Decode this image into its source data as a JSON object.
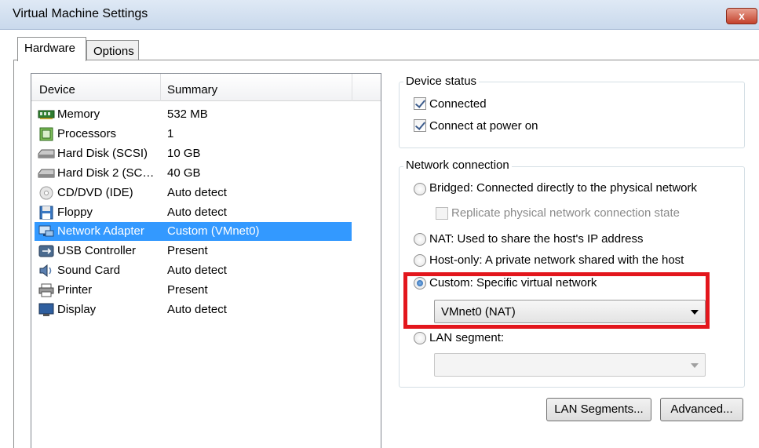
{
  "window": {
    "title": "Virtual Machine Settings",
    "close_label": "x"
  },
  "tabs": [
    {
      "label": "Hardware",
      "active": true
    },
    {
      "label": "Options",
      "active": false
    }
  ],
  "device_list": {
    "headers": {
      "device": "Device",
      "summary": "Summary"
    },
    "rows": [
      {
        "icon": "memory-icon",
        "device": "Memory",
        "summary": "532 MB"
      },
      {
        "icon": "processor-icon",
        "device": "Processors",
        "summary": "1"
      },
      {
        "icon": "hard-disk-icon",
        "device": "Hard Disk (SCSI)",
        "summary": "10 GB"
      },
      {
        "icon": "hard-disk-icon",
        "device": "Hard Disk 2 (SC…",
        "summary": "40 GB"
      },
      {
        "icon": "cd-dvd-icon",
        "device": "CD/DVD (IDE)",
        "summary": "Auto detect"
      },
      {
        "icon": "floppy-icon",
        "device": "Floppy",
        "summary": "Auto detect"
      },
      {
        "icon": "network-adapter-icon",
        "device": "Network Adapter",
        "summary": "Custom (VMnet0)",
        "selected": true
      },
      {
        "icon": "usb-icon",
        "device": "USB Controller",
        "summary": "Present"
      },
      {
        "icon": "sound-icon",
        "device": "Sound Card",
        "summary": "Auto detect"
      },
      {
        "icon": "printer-icon",
        "device": "Printer",
        "summary": "Present"
      },
      {
        "icon": "display-icon",
        "device": "Display",
        "summary": "Auto detect"
      }
    ]
  },
  "device_status": {
    "label": "Device status",
    "connected": {
      "label": "Connected",
      "checked": true
    },
    "connect_at_power_on": {
      "label": "Connect at power on",
      "checked": true
    }
  },
  "network_connection": {
    "label": "Network connection",
    "bridged": {
      "label": "Bridged: Connected directly to the physical network",
      "selected": false
    },
    "replicate": {
      "label": "Replicate physical network connection state",
      "checked": false,
      "enabled": false
    },
    "nat": {
      "label": "NAT: Used to share the host's IP address",
      "selected": false
    },
    "host_only": {
      "label": "Host-only: A private network shared with the host",
      "selected": false
    },
    "custom": {
      "label": "Custom: Specific virtual network",
      "selected": true,
      "value": "VMnet0 (NAT)"
    },
    "lan_segment": {
      "label": "LAN segment:",
      "selected": false,
      "value": ""
    }
  },
  "buttons": {
    "lan_segments": "LAN Segments...",
    "advanced": "Advanced..."
  },
  "colors": {
    "selection": "#3399ff",
    "highlight_box": "#e3161c"
  }
}
